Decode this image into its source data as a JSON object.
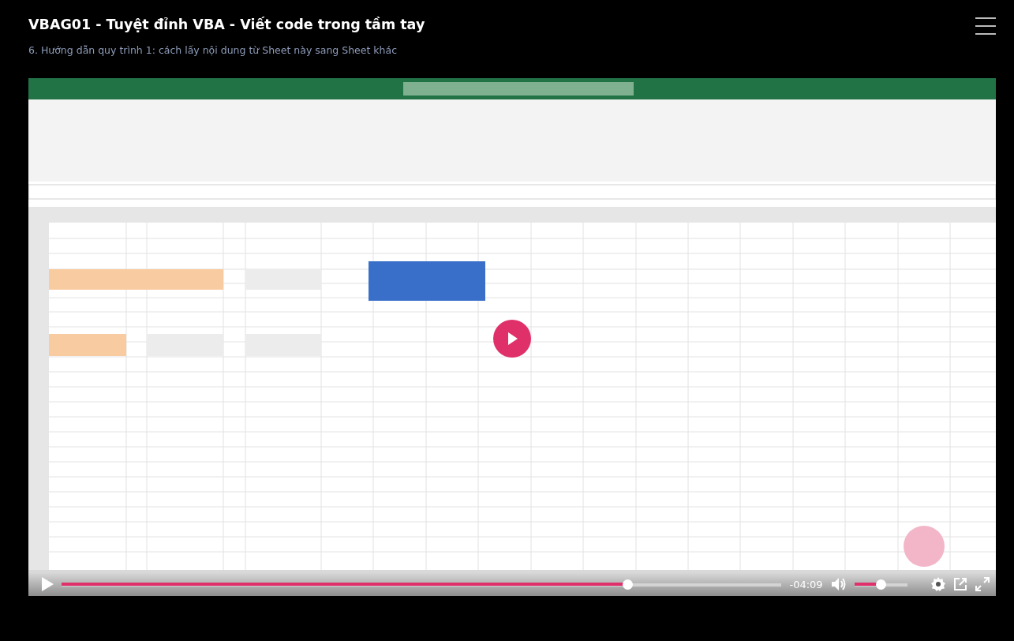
{
  "course": {
    "title": "VBAG01 - Tuyệt đỉnh VBA - Viết code trong tầm tay",
    "lesson": "6. Hướng dẫn quy trình 1: cách lấy nội dung từ Sheet này sang Sheet khác"
  },
  "video": {
    "playing": false,
    "progress": {
      "level": 0.79
    },
    "time": "-04:09",
    "volume": {
      "level": 0.5,
      "muted": false
    }
  }
}
